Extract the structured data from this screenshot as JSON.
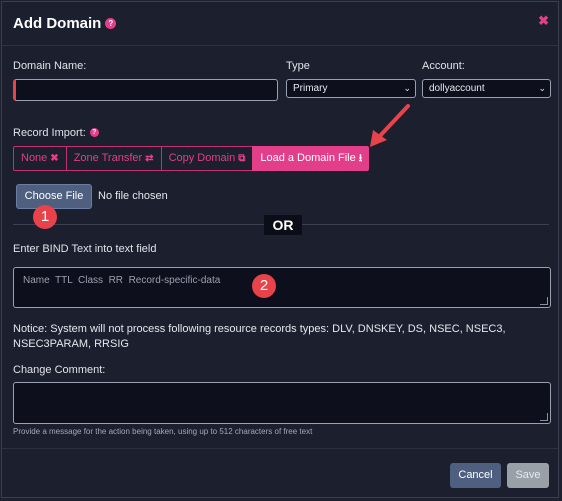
{
  "modal": {
    "title": "Add Domain",
    "help_icon": "question-circle-icon",
    "close_icon": "close-icon"
  },
  "form": {
    "domain_name_label": "Domain Name:",
    "domain_name_value": "",
    "type_label": "Type",
    "type_value": "Primary",
    "account_label": "Account:",
    "account_value": "dollyaccount",
    "record_import_label": "Record Import:",
    "import_tabs": [
      {
        "label": "None",
        "icon": "✖"
      },
      {
        "label": "Zone Transfer",
        "icon": "⇄"
      },
      {
        "label": "Copy Domain",
        "icon": "⧉"
      },
      {
        "label": "Load a Domain File",
        "icon": "⭳"
      }
    ],
    "active_tab": "Load a Domain File",
    "choose_file_label": "Choose File",
    "no_file_text": "No file chosen",
    "or_text": "OR",
    "bind_label": "Enter BIND Text into text field",
    "bind_placeholder": "Name  TTL  Class  RR  Record-specific-data",
    "notice": "Notice: System will not process following resource records types: DLV, DNSKEY, DS, NSEC, NSEC3, NSEC3PARAM, RRSIG",
    "change_comment_label": "Change Comment:",
    "change_comment_hint": "Provide a message for the action being taken, using up to 512 characters of free text"
  },
  "footer": {
    "cancel_label": "Cancel",
    "save_label": "Save"
  },
  "annotations": {
    "badge_1": "1",
    "badge_2": "2"
  },
  "colors": {
    "accent": "#e23e8a",
    "background": "#1c1f2e",
    "input_bg": "#0d101c",
    "button": "#4e5f80",
    "annotation": "#e8434a"
  }
}
